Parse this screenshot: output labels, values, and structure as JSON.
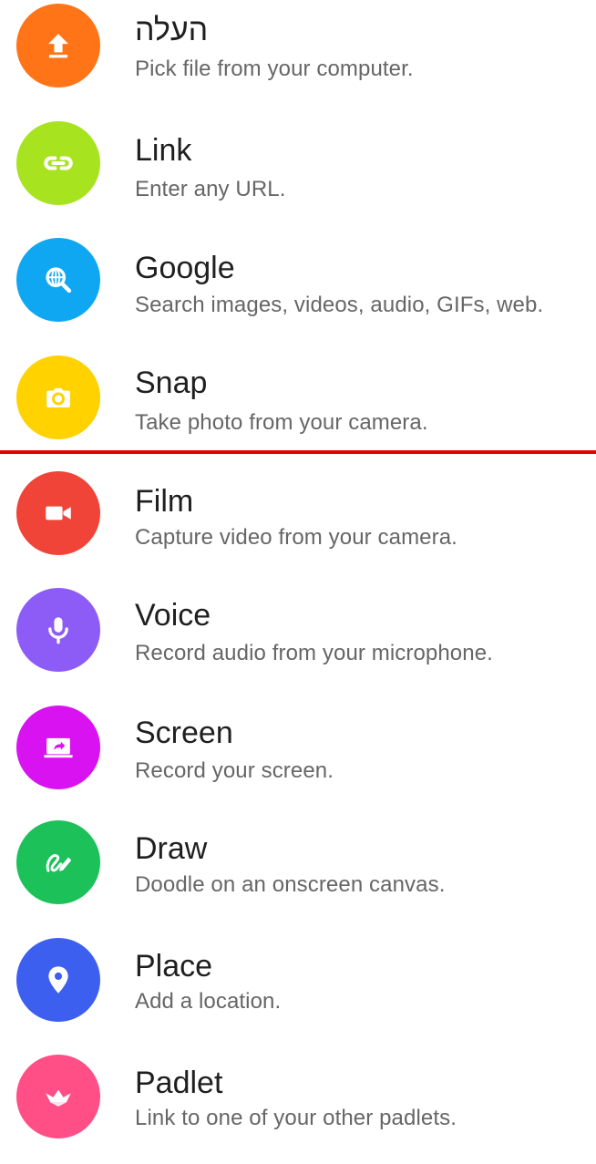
{
  "items": [
    {
      "title": "העלה",
      "subtitle": "Pick file from your computer.",
      "icon": "upload-icon",
      "color": "#ff7417"
    },
    {
      "title": "Link",
      "subtitle": "Enter any URL.",
      "icon": "link-icon",
      "color": "#a8e320"
    },
    {
      "title": "Google",
      "subtitle": "Search images, videos, audio, GIFs, web.",
      "icon": "web-search-icon",
      "color": "#10a7f2"
    },
    {
      "title": "Snap",
      "subtitle": "Take photo from your camera.",
      "icon": "camera-icon",
      "color": "#ffd200"
    },
    {
      "title": "Film",
      "subtitle": "Capture video from your camera.",
      "icon": "video-camera-icon",
      "color": "#f04438"
    },
    {
      "title": "Voice",
      "subtitle": "Record audio from your microphone.",
      "icon": "microphone-icon",
      "color": "#8d5cf6"
    },
    {
      "title": "Screen",
      "subtitle": "Record your screen.",
      "icon": "screen-record-icon",
      "color": "#d812f0"
    },
    {
      "title": "Draw",
      "subtitle": "Doodle on an onscreen canvas.",
      "icon": "draw-icon",
      "color": "#1cc15a"
    },
    {
      "title": "Place",
      "subtitle": "Add a location.",
      "icon": "location-pin-icon",
      "color": "#3d5ff0"
    },
    {
      "title": "Padlet",
      "subtitle": "Link to one of your other padlets.",
      "icon": "padlet-icon",
      "color": "#ff4f86"
    }
  ],
  "divider_color": "#e60000"
}
